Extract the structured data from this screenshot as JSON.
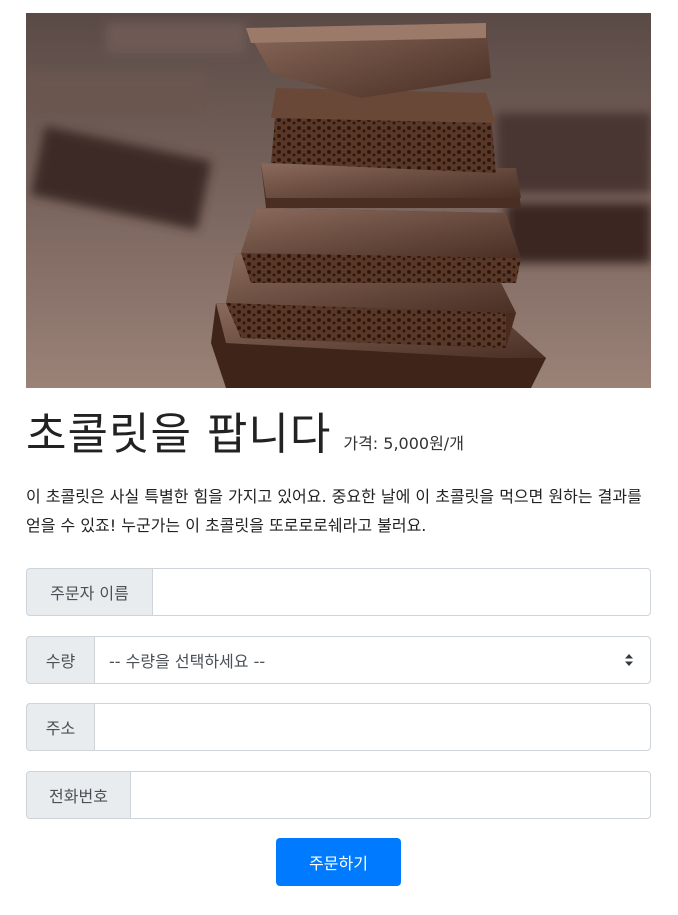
{
  "product": {
    "title": "초콜릿을 팝니다",
    "price": "가격: 5,000원/개",
    "description": "이 초콜릿은 사실 특별한 힘을 가지고 있어요. 중요한 날에 이 초콜릿을 먹으면 원하는 결과를 얻을 수 있죠! 누군가는 이 초콜릿을 또로로로쉐라고 불러요."
  },
  "form": {
    "name_label": "주문자 이름",
    "name_value": "",
    "quantity_label": "수량",
    "quantity_selected": "-- 수량을 선택하세요 --",
    "address_label": "주소",
    "address_value": "",
    "phone_label": "전화번호",
    "phone_value": "",
    "submit_label": "주문하기"
  },
  "colors": {
    "primary": "#007bff",
    "addon_bg": "#e9ecef",
    "border": "#ced4da"
  }
}
